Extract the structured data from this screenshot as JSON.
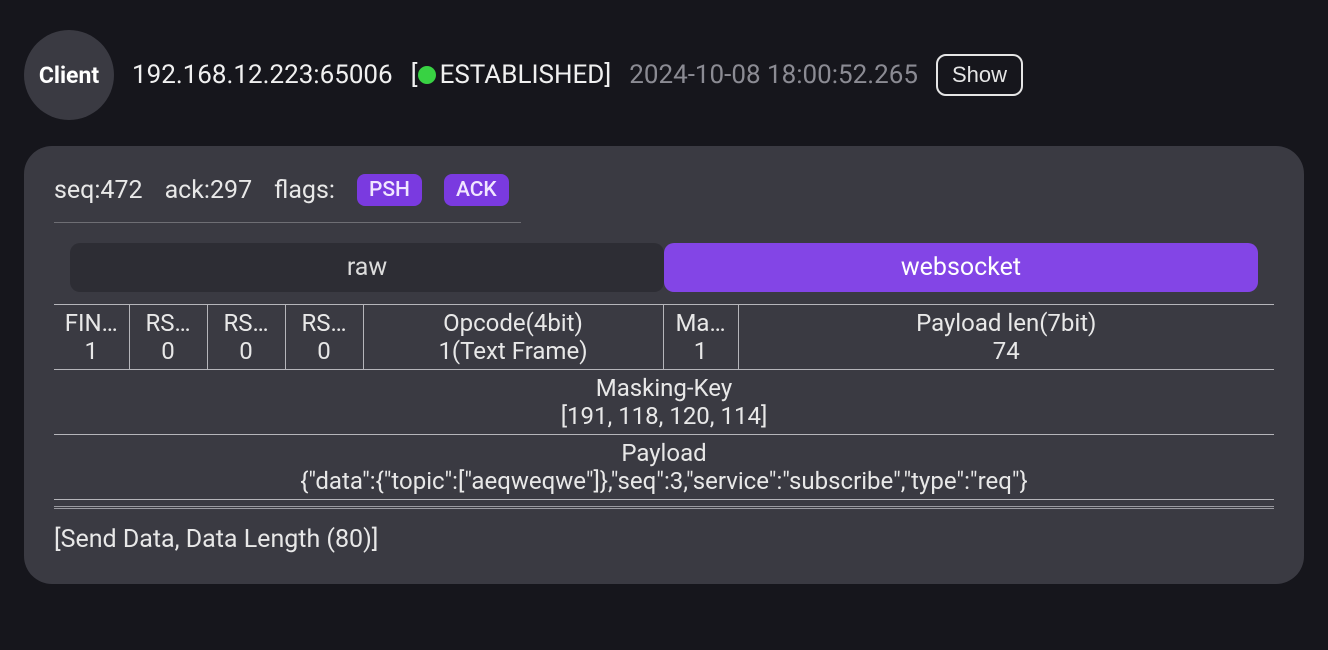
{
  "header": {
    "role": "Client",
    "address": "192.168.12.223:65006",
    "status_label": "ESTABLISHED",
    "timestamp": "2024-10-08 18:00:52.265",
    "show_label": "Show"
  },
  "meta": {
    "seq_label": "seq:472",
    "ack_label": "ack:297",
    "flags_label": "flags:",
    "flags": [
      "PSH",
      "ACK"
    ]
  },
  "tabs": {
    "raw": "raw",
    "websocket": "websocket",
    "active": "websocket"
  },
  "ws_table": {
    "cols": [
      {
        "h": "FIN…",
        "v": "1"
      },
      {
        "h": "RS…",
        "v": "0"
      },
      {
        "h": "RS…",
        "v": "0"
      },
      {
        "h": "RS…",
        "v": "0"
      },
      {
        "h": "Opcode(4bit)",
        "v": "1(Text Frame)"
      },
      {
        "h": "Ma…",
        "v": "1"
      },
      {
        "h": "Payload len(7bit)",
        "v": "74"
      }
    ],
    "masking_key_label": "Masking-Key",
    "masking_key_value": "[191, 118, 120, 114]",
    "payload_label": "Payload",
    "payload_value": "{\"data\":{\"topic\":[\"aeqweqwe\"]},\"seq\":3,\"service\":\"subscribe\",\"type\":\"req\"}"
  },
  "footer": {
    "send": "[Send Data, Data Length (80)]"
  }
}
